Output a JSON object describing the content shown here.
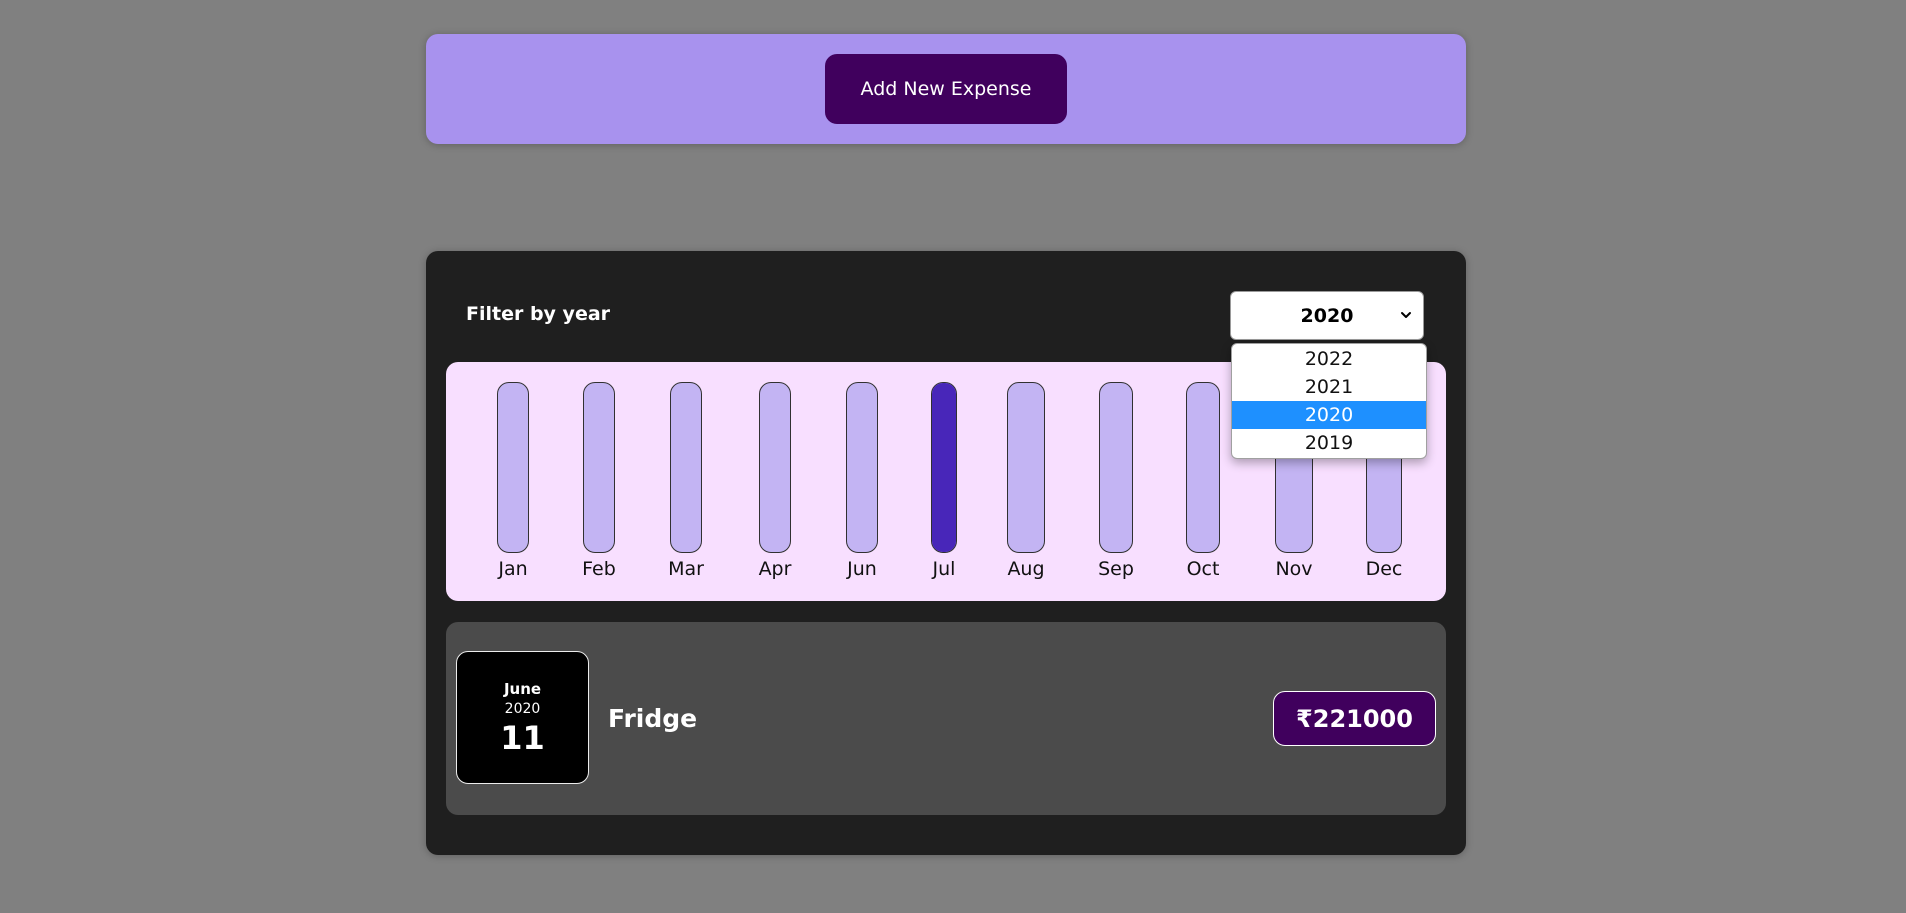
{
  "new_expense": {
    "button_label": "Add New Expense"
  },
  "filter": {
    "label": "Filter by year",
    "selected_year": "2020",
    "options": [
      "2022",
      "2021",
      "2020",
      "2019"
    ],
    "highlighted_option": "2020"
  },
  "chart": {
    "bars": [
      {
        "label": "Jan",
        "fill": 0
      },
      {
        "label": "Feb",
        "fill": 0
      },
      {
        "label": "Mar",
        "fill": 0
      },
      {
        "label": "Apr",
        "fill": 0
      },
      {
        "label": "Jun",
        "fill": 0
      },
      {
        "label": "Jul",
        "fill": 1
      },
      {
        "label": "Aug",
        "fill": 0
      },
      {
        "label": "Sep",
        "fill": 0
      },
      {
        "label": "Oct",
        "fill": 0
      },
      {
        "label": "Nov",
        "fill": 0
      },
      {
        "label": "Dec",
        "fill": 0
      }
    ]
  },
  "expenses": [
    {
      "month": "June",
      "year": "2020",
      "day": "11",
      "title": "Fridge",
      "price": "₹221000"
    }
  ],
  "colors": {
    "page_background": "#808080",
    "new_expense_panel": "#a892ee",
    "accent_dark_purple": "#40005d",
    "card_background": "#1f1f1f",
    "chart_background": "#f8dfff",
    "bar_track": "#c3b4f3",
    "bar_fill": "#4826b9",
    "item_background": "#4b4b4b",
    "selected_option": "#1e90ff"
  },
  "icons": {
    "select_arrow": "chevron-down-icon"
  }
}
